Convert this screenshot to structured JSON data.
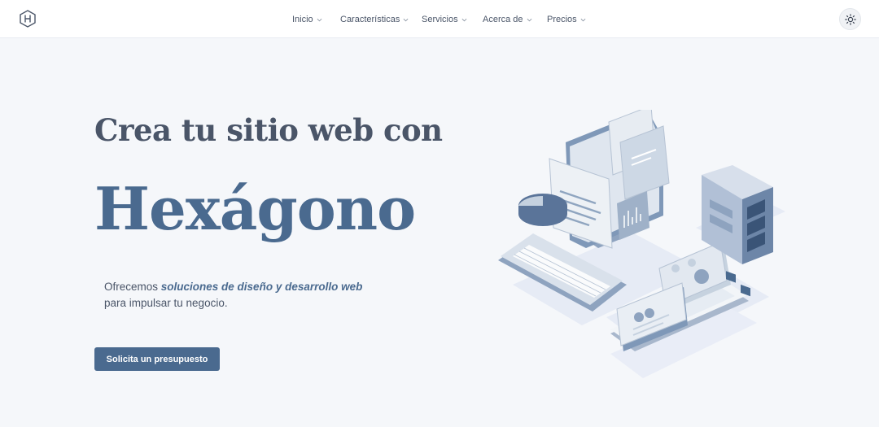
{
  "header": {
    "logo_icon": "hexagon-h-logo",
    "nav": [
      {
        "label": "Inicio",
        "icon": "chevron-down-icon"
      },
      {
        "label": "Características",
        "icon": "chevron-down-icon"
      },
      {
        "label": "Servicios",
        "icon": "chevron-down-icon"
      },
      {
        "label": "Acerca de",
        "icon": "chevron-down-icon"
      },
      {
        "label": "Precios",
        "icon": "chevron-down-icon"
      }
    ],
    "theme_toggle_icon": "sun-icon"
  },
  "hero": {
    "title_line1": "Crea tu sitio web con",
    "title_line2": "Hexágono",
    "description_prefix": "Ofrecemos ",
    "description_emphasis": "soluciones de diseño y desarrollo web",
    "description_suffix": " para impulsar tu negocio.",
    "cta_label": "Solicita un presupuesto",
    "illustration_icon": "isometric-devices-illustration"
  },
  "colors": {
    "accent": "#4a6a8f",
    "background": "#f5f7fa",
    "header_bg": "#ffffff",
    "text": "#4a5568"
  }
}
